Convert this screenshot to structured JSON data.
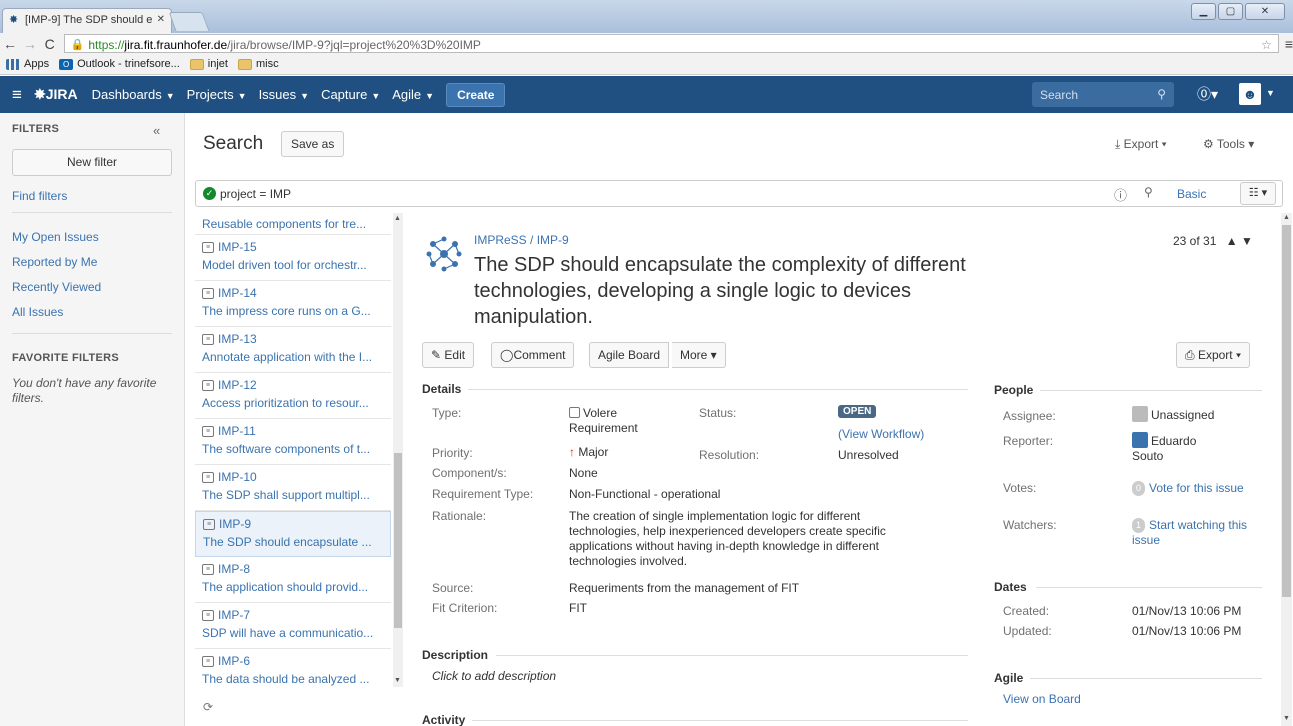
{
  "browser": {
    "tab_title": "[IMP-9] The SDP should e",
    "url_scheme": "https://",
    "url_host": "jira.fit.fraunhofer.de",
    "url_path": "/jira/browse/IMP-9?jql=project%20%3D%20IMP",
    "bookmarks": [
      "Apps",
      "Outlook - trinefsore...",
      "injet",
      "misc"
    ]
  },
  "header": {
    "logo": "JIRA",
    "nav": [
      "Dashboards",
      "Projects",
      "Issues",
      "Capture",
      "Agile"
    ],
    "create_label": "Create",
    "search_placeholder": "Search"
  },
  "sidebar": {
    "title": "FILTERS",
    "new_filter": "New filter",
    "find_filters": "Find filters",
    "links": [
      "My Open Issues",
      "Reported by Me",
      "Recently Viewed",
      "All Issues"
    ],
    "favorites_title": "FAVORITE FILTERS",
    "favorites_empty": "You don't have any favorite filters."
  },
  "search": {
    "title": "Search",
    "save_as": "Save as",
    "export_label": "Export",
    "tools_label": "Tools",
    "jql": "project = IMP",
    "basic_label": "Basic"
  },
  "issue_list": {
    "first_summary": "Reusable components for tre...",
    "items": [
      {
        "key": "IMP-15",
        "summary": "Model driven tool for orchestr..."
      },
      {
        "key": "IMP-14",
        "summary": "The impress core runs on a G..."
      },
      {
        "key": "IMP-13",
        "summary": "Annotate application with the I..."
      },
      {
        "key": "IMP-12",
        "summary": "Access prioritization to resour..."
      },
      {
        "key": "IMP-11",
        "summary": "The software components of t..."
      },
      {
        "key": "IMP-10",
        "summary": "The SDP shall support multipl..."
      },
      {
        "key": "IMP-9",
        "summary": "The SDP should encapsulate ..."
      },
      {
        "key": "IMP-8",
        "summary": "The application should provid..."
      },
      {
        "key": "IMP-7",
        "summary": "SDP will have a communicatio..."
      },
      {
        "key": "IMP-6",
        "summary": "The data should be analyzed ..."
      }
    ],
    "selected_index": 6
  },
  "issue": {
    "project": "IMPReSS",
    "key": "IMP-9",
    "pager": "23 of 31",
    "title": "The SDP should encapsulate the complexity of different technologies, developing a single logic to devices manipulation.",
    "buttons": {
      "edit": "Edit",
      "comment": "Comment",
      "agile_board": "Agile Board",
      "more": "More",
      "export": "Export"
    },
    "details_title": "Details",
    "labels": {
      "type": "Type:",
      "status": "Status:",
      "priority": "Priority:",
      "resolution": "Resolution:",
      "components": "Component/s:",
      "req_type": "Requirement Type:",
      "rationale": "Rationale:",
      "source": "Source:",
      "fit": "Fit Criterion:"
    },
    "values": {
      "type_line1": "Volere",
      "type_line2": "Requirement",
      "status": "OPEN",
      "view_workflow": "(View Workflow)",
      "priority": "Major",
      "resolution": "Unresolved",
      "components": "None",
      "req_type": "Non-Functional - operational",
      "rationale_lines": [
        "The creation of single implementation logic for different",
        "technologies, help inexperienced developers create specific",
        "applications without having in-depth knowledge in different",
        "technologies involved."
      ],
      "source": "Requeriments from the management of FIT",
      "fit": "FIT"
    },
    "description_title": "Description",
    "description_placeholder": "Click to add description",
    "activity_title": "Activity",
    "people": {
      "title": "People",
      "assignee_label": "Assignee:",
      "assignee": "Unassigned",
      "reporter_label": "Reporter:",
      "reporter_line1": "Eduardo",
      "reporter_line2": "Souto",
      "votes_label": "Votes:",
      "votes_count": "0",
      "votes_link": "Vote for this issue",
      "watchers_label": "Watchers:",
      "watchers_count": "1",
      "watch_line1": "Start watching this",
      "watch_line2": "issue"
    },
    "dates": {
      "title": "Dates",
      "created_label": "Created:",
      "created": "01/Nov/13 10:06 PM",
      "updated_label": "Updated:",
      "updated": "01/Nov/13 10:06 PM"
    },
    "agile": {
      "title": "Agile",
      "view_on_board": "View on Board"
    }
  },
  "colors": {
    "header_bg": "#205081",
    "link": "#3b73af",
    "open_badge": "#4a6785",
    "success": "#14892c"
  }
}
